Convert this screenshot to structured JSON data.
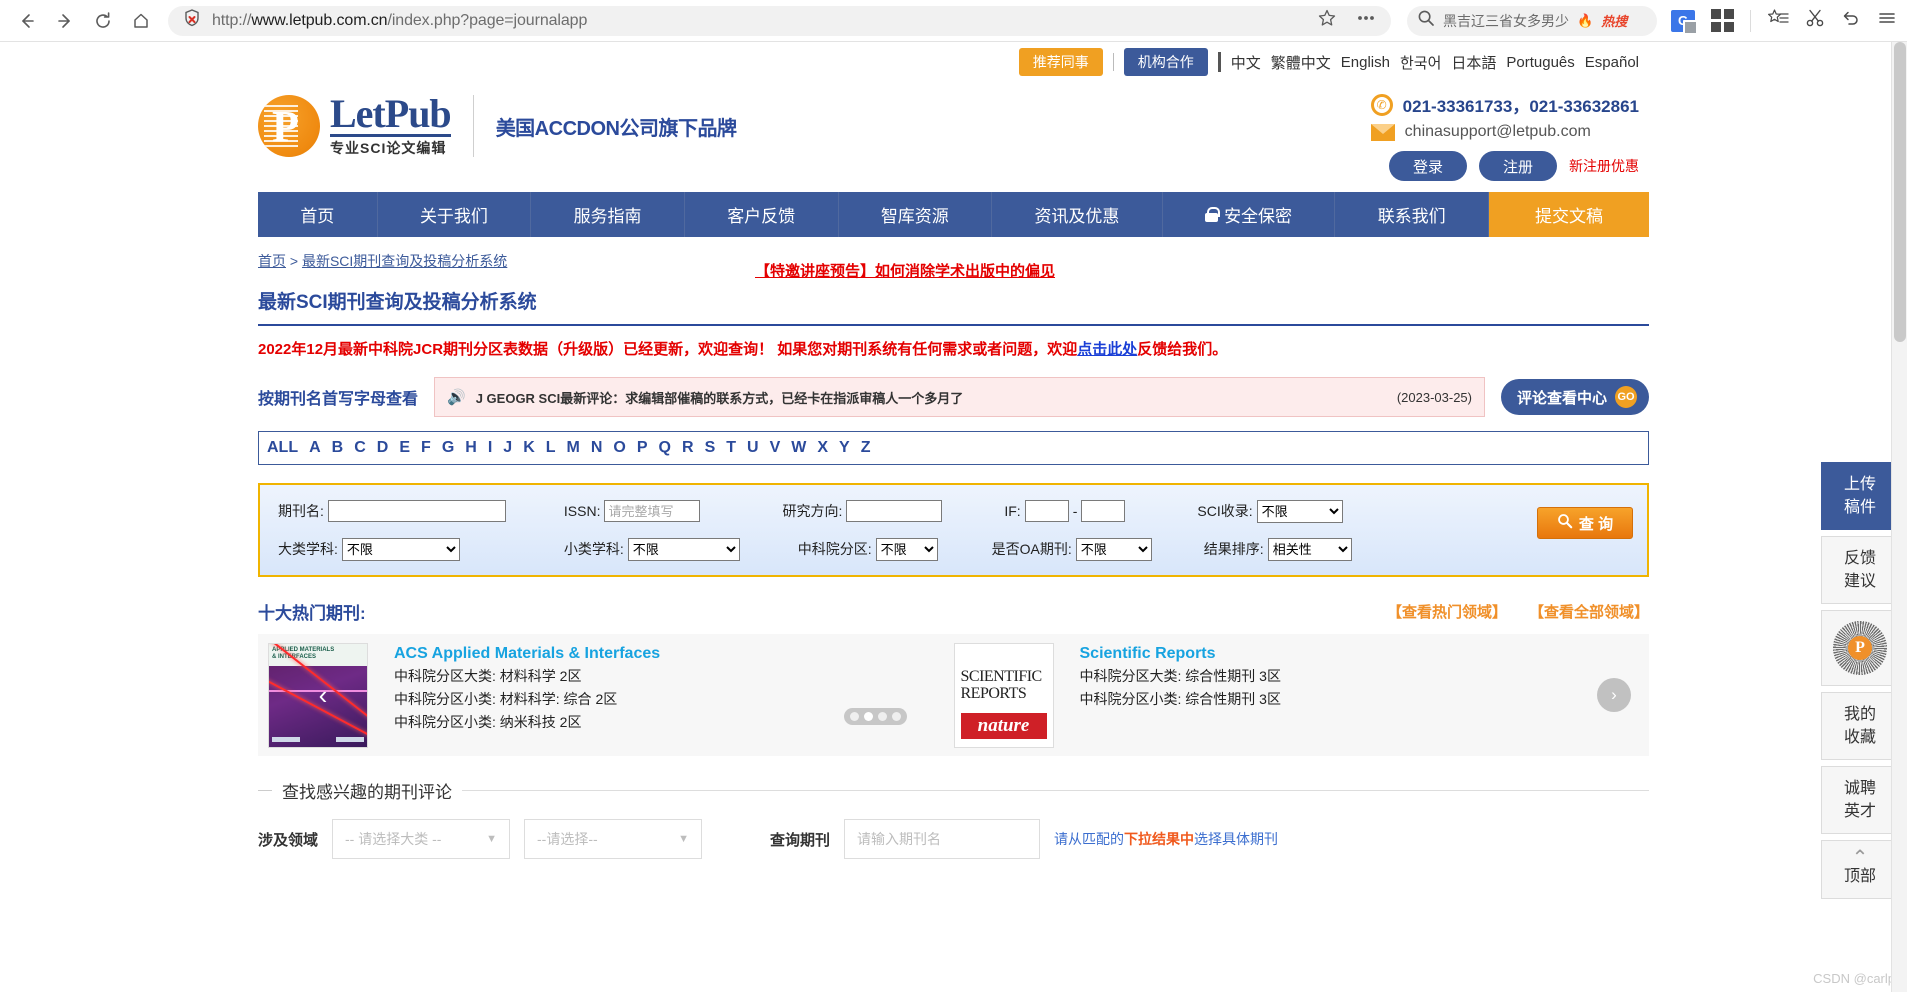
{
  "browser": {
    "url_scheme": "http://",
    "url_main": "www.letpub.com.cn",
    "url_path": "/index.php?page=journalapp",
    "search_query": "黑吉辽三省女多男少",
    "hot_tag": "热搜",
    "icons": {
      "back": "back-arrow-icon",
      "forward": "forward-arrow-icon",
      "reload": "reload-icon",
      "home": "home-icon",
      "shield": "shield-insecure-icon",
      "bookmark": "star-icon",
      "more": "ellipsis-icon",
      "search": "search-icon",
      "translate": "google-translate-icon",
      "apps": "app-grid-icon",
      "collect": "favorites-icon",
      "scissors": "screenshot-scissors-icon",
      "undo": "undo-icon",
      "menu": "hamburger-menu-icon"
    }
  },
  "langbar": {
    "recommend": "推荐同事",
    "institution": "机构合作",
    "languages": [
      "中文",
      "繁體中文",
      "English",
      "한국어",
      "日本語",
      "Português",
      "Español"
    ]
  },
  "header": {
    "logo_name": "LetPub",
    "logo_sub": "专业SCI论文编辑",
    "brand_line": "美国ACCDON公司旗下品牌",
    "notice_link": "【特邀讲座预告】如何消除学术出版中的偏见",
    "phone": "021-33361733，021-33632861",
    "email": "chinasupport@letpub.com",
    "login": "登录",
    "register": "注册",
    "register_note": "新注册优惠"
  },
  "nav": {
    "items": [
      "首页",
      "关于我们",
      "服务指南",
      "客户反馈",
      "智库资源",
      "资讯及优惠",
      "安全保密",
      "联系我们"
    ],
    "submit": "提交文稿"
  },
  "content": {
    "breadcrumb_home": "首页",
    "breadcrumb_sep": " > ",
    "breadcrumb_current": "最新SCI期刊查询及投稿分析系统",
    "page_title": "最新SCI期刊查询及投稿分析系统",
    "red_notice_a": "2022年12月最新中科院JCR期刊分区表数据（升级版）已经更新，欢迎查询！ 如果您对期刊系统有任何需求或者问题，欢迎",
    "red_notice_link": "点击此处",
    "red_notice_b": "反馈给我们。",
    "announce_label": "按期刊名首写字母查看",
    "announce_text": "J GEOGR SCI最新评论：求编辑部催稿的联系方式，已经卡在指派审稿人一个多月了",
    "announce_date": "(2023-03-25)",
    "review_center": "评论查看中心",
    "review_center_go": "GO",
    "alphabet": [
      "ALL",
      "A",
      "B",
      "C",
      "D",
      "E",
      "F",
      "G",
      "H",
      "I",
      "J",
      "K",
      "L",
      "M",
      "N",
      "O",
      "P",
      "Q",
      "R",
      "S",
      "T",
      "U",
      "V",
      "W",
      "X",
      "Y",
      "Z"
    ]
  },
  "search_form": {
    "journal_label": "期刊名:",
    "journal_value": "",
    "issn_label": "ISSN:",
    "issn_placeholder": "请完整填写",
    "field_label": "研究方向:",
    "field_value": "",
    "if_label": "IF:",
    "if_min": "",
    "if_max": "",
    "sci_label": "SCI收录:",
    "sci_value": "不限",
    "major_label": "大类学科:",
    "major_value": "不限",
    "minor_label": "小类学科:",
    "minor_value": "不限",
    "zone_label": "中科院分区:",
    "zone_value": "不限",
    "oa_label": "是否OA期刊:",
    "oa_value": "不限",
    "sort_label": "结果排序:",
    "sort_value": "相关性",
    "submit_label": "查 询"
  },
  "hot": {
    "title": "十大热门期刊:",
    "link_hot": "【查看热门领域】",
    "link_all": "【查看全部领域】",
    "journals": [
      {
        "name": "ACS Applied Materials & Interfaces",
        "cover_line1": "APPLIED MATERIALS",
        "cover_line2": "& INTERFACES",
        "meta": [
          "中科院分区大类: 材料科学 2区",
          "中科院分区小类: 材料科学: 综合 2区",
          "中科院分区小类: 纳米科技 2区"
        ]
      },
      {
        "name": "Scientific Reports",
        "cover_line1": "SCIENTIFIC",
        "cover_line2": "REPORTS",
        "cover_brand": "nature",
        "meta": [
          "中科院分区大类: 综合性期刊 3区",
          "中科院分区小类: 综合性期刊 3区"
        ]
      }
    ]
  },
  "finder": {
    "legend": "查找感兴趣的期刊评论",
    "field_label": "涉及领域",
    "select1": "-- 请选择大类 --",
    "select2": "--请选择--",
    "journal_label": "查询期刊",
    "journal_placeholder": "请输入期刊名",
    "hint_a": "请从匹配的",
    "hint_b": "下拉结果中",
    "hint_c": "选择具体期刊"
  },
  "rail": {
    "items": [
      {
        "label_1": "上传",
        "label_2": "稿件",
        "name": "upload-manuscript"
      },
      {
        "label_1": "反馈",
        "label_2": "建议",
        "name": "feedback-suggestion"
      },
      {
        "label_1": "",
        "label_2": "",
        "name": "wechat-qr"
      },
      {
        "label_1": "我的",
        "label_2": "收藏",
        "name": "my-favorites"
      },
      {
        "label_1": "诚聘",
        "label_2": "英才",
        "name": "careers"
      },
      {
        "label_1": "顶部",
        "label_2": "",
        "name": "back-to-top"
      }
    ]
  },
  "watermark": "CSDN @carlp"
}
